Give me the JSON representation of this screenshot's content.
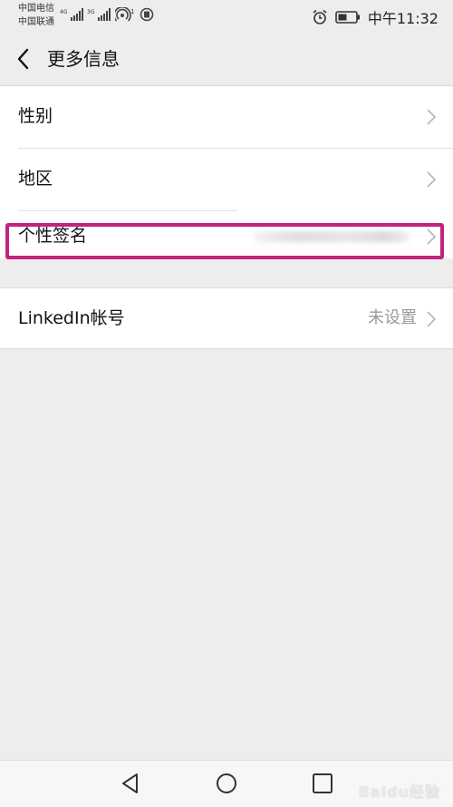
{
  "status_bar": {
    "carrier_1": "中国电信",
    "carrier_2": "中国联通",
    "net_1": "4G",
    "net_2": "3G",
    "hotspot_count": "1",
    "time": "中午11:32"
  },
  "header": {
    "title": "更多信息"
  },
  "rows": [
    {
      "label": "性别"
    },
    {
      "label": "地区"
    },
    {
      "label": "个性签名"
    },
    {
      "label": "LinkedIn帐号",
      "value": "未设置"
    }
  ],
  "colors": {
    "highlight": "#c2237f",
    "background": "#ededed"
  },
  "watermark": "Baidu经验"
}
